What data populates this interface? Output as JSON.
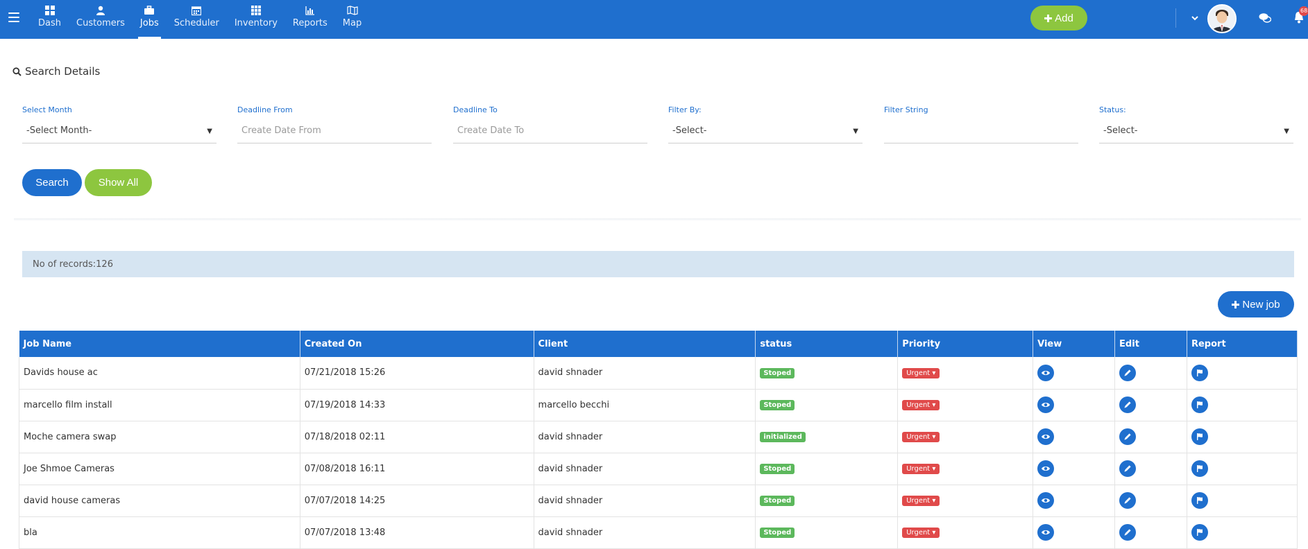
{
  "nav": {
    "items": [
      {
        "label": "Dash",
        "icon": "dashboard-icon"
      },
      {
        "label": "Customers",
        "icon": "user-icon"
      },
      {
        "label": "Jobs",
        "icon": "briefcase-icon"
      },
      {
        "label": "Scheduler",
        "icon": "calendar-icon"
      },
      {
        "label": "Inventory",
        "icon": "grid-icon"
      },
      {
        "label": "Reports",
        "icon": "bar-chart-icon"
      },
      {
        "label": "Map",
        "icon": "map-icon"
      }
    ],
    "active": "Jobs",
    "add_label": "Add",
    "notification_count": "68"
  },
  "search": {
    "title": "Search Details",
    "fields": [
      {
        "label": "Select Month",
        "value": "-Select Month-",
        "type": "select"
      },
      {
        "label": "Deadline From",
        "value": "Create Date From",
        "type": "placeholder"
      },
      {
        "label": "Deadline To",
        "value": "Create Date To",
        "type": "placeholder"
      },
      {
        "label": "Filter By:",
        "value": "-Select-",
        "type": "select"
      },
      {
        "label": "Filter String",
        "value": "",
        "type": "text"
      },
      {
        "label": "Status:",
        "value": "-Select-",
        "type": "select"
      }
    ],
    "search_label": "Search",
    "show_all_label": "Show All"
  },
  "records_text": "No of records:126",
  "new_job_label": "New job",
  "table": {
    "columns": [
      "Job Name",
      "Created On",
      "Client",
      "status",
      "Priority",
      "View",
      "Edit",
      "Report"
    ],
    "rows": [
      {
        "name": "Davids house ac",
        "created": "07/21/2018 15:26",
        "client": "david shnader",
        "status": "Stoped",
        "priority": "Urgent"
      },
      {
        "name": "marcello film install",
        "created": "07/19/2018 14:33",
        "client": "marcello becchi",
        "status": "Stoped",
        "priority": "Urgent"
      },
      {
        "name": "Moche camera swap",
        "created": "07/18/2018 02:11",
        "client": "david shnader",
        "status": "initialized",
        "priority": "Urgent"
      },
      {
        "name": "Joe Shmoe Cameras",
        "created": "07/08/2018 16:11",
        "client": "david shnader",
        "status": "Stoped",
        "priority": "Urgent"
      },
      {
        "name": "david house cameras",
        "created": "07/07/2018 14:25",
        "client": "david shnader",
        "status": "Stoped",
        "priority": "Urgent"
      },
      {
        "name": "bla",
        "created": "07/07/2018 13:48",
        "client": "david shnader",
        "status": "Stoped",
        "priority": "Urgent"
      }
    ]
  },
  "colors": {
    "primary": "#1f6fce",
    "accent_green": "#8dc63f",
    "status_green": "#5cb85c",
    "urgent_red": "#e04a4a",
    "records_bg": "#d6e5f2"
  }
}
